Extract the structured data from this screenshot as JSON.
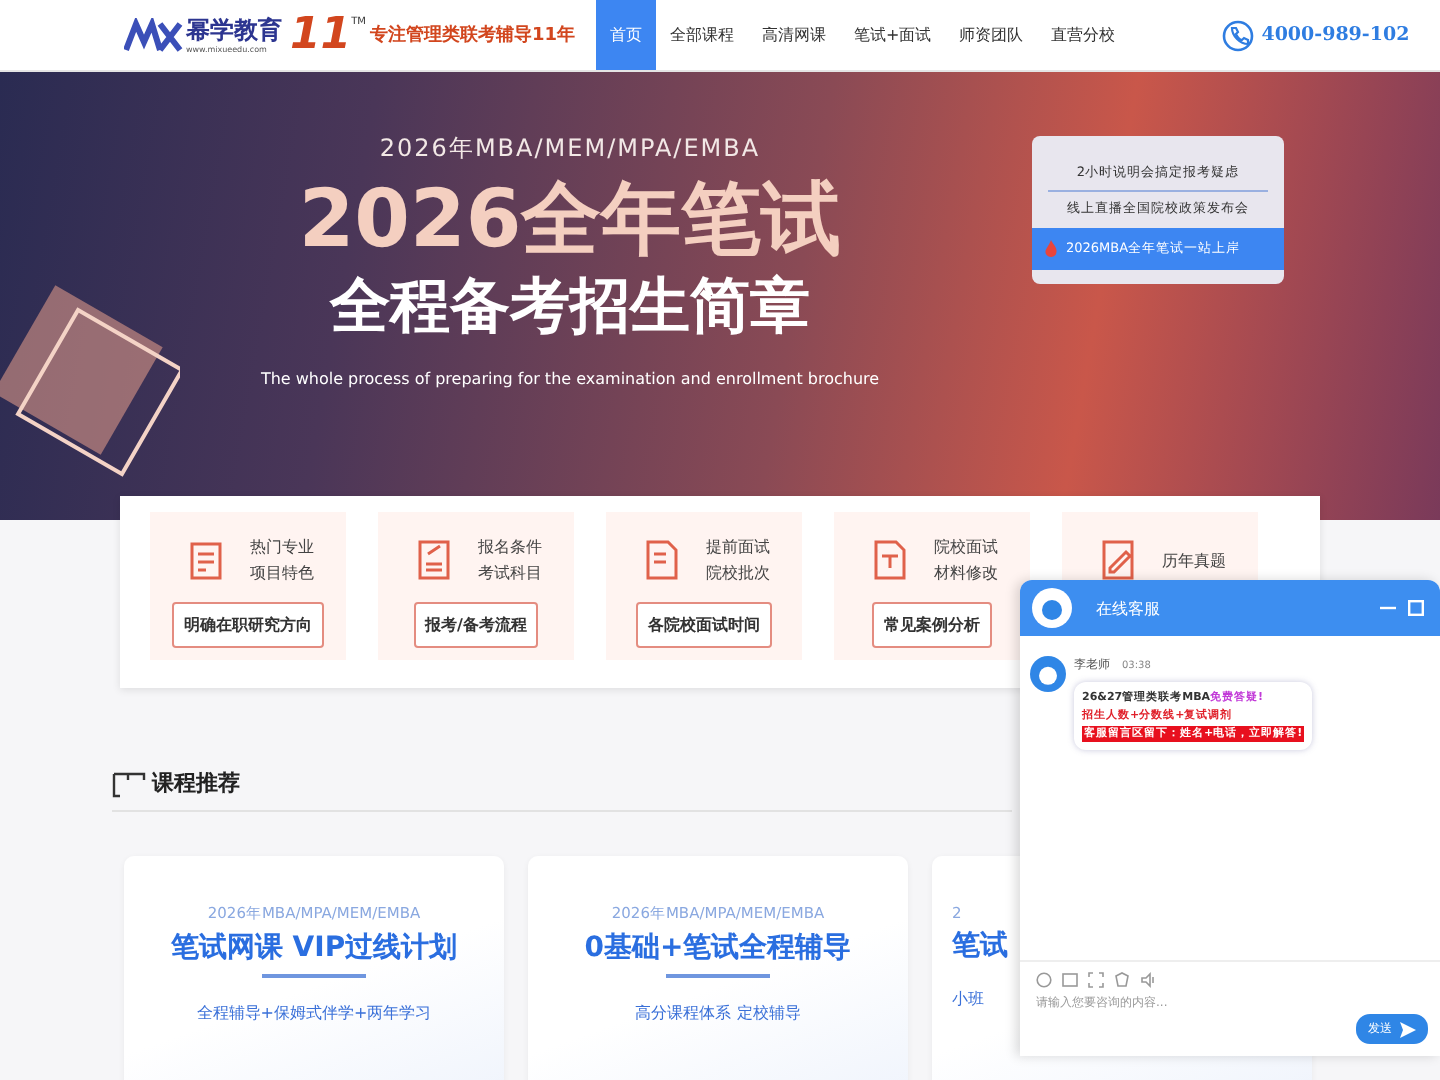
{
  "header": {
    "logo": {
      "brand": "幂学教育",
      "url": "www.mixueedu.com",
      "years": "11",
      "tm": "TM",
      "slogan": "专注管理类联考辅导11年"
    },
    "nav": [
      {
        "label": "首页",
        "selected": true
      },
      {
        "label": "全部课程",
        "selected": false
      },
      {
        "label": "高清网课",
        "selected": false
      },
      {
        "label": "笔试+面试",
        "selected": false
      },
      {
        "label": "师资团队",
        "selected": false
      },
      {
        "label": "直营分校",
        "selected": false
      }
    ],
    "phone": "4000-989-102"
  },
  "banner": {
    "kicker": "2026年MBA/MEM/MPA/EMBA",
    "title": "2026全年笔试",
    "subtitle": "全程备考招生简章",
    "english": "The whole process of preparing for the examination and enrollment brochure",
    "links": [
      {
        "label": "2小时说明会搞定报考疑虑",
        "selected": false
      },
      {
        "label": "线上直播全国院校政策发布会",
        "selected": false
      },
      {
        "label": "2026MBA全年笔试一站上岸",
        "selected": true
      }
    ]
  },
  "features": [
    {
      "lines": [
        "热门专业",
        "项目特色"
      ],
      "button": "明确在职研究方向"
    },
    {
      "lines": [
        "报名条件",
        "考试科目"
      ],
      "button": "报考/备考流程"
    },
    {
      "lines": [
        "提前面试",
        "院校批次"
      ],
      "button": "各院校面试时间"
    },
    {
      "lines": [
        "院校面试",
        "材料修改"
      ],
      "button": "常见案例分析"
    },
    {
      "lines": [
        "历年真题"
      ]
    }
  ],
  "section": {
    "title": "课程推荐"
  },
  "cards": [
    {
      "kind": "full",
      "kicker": "2026年MBA/MPA/MEM/EMBA",
      "title": "笔试网课 VIP过线计划",
      "tagline": "全程辅导+保姆式伴学+两年学习"
    },
    {
      "kind": "full",
      "kicker": "2026年MBA/MPA/MEM/EMBA",
      "title": "0基础+笔试全程辅导",
      "tagline": "高分课程体系 定校辅导"
    },
    {
      "kind": "cut",
      "kicker": "2",
      "title": "笔试",
      "tagline": "小班"
    }
  ],
  "chat": {
    "title": "在线客服",
    "agent": "李老师",
    "time": "03:38",
    "lines": [
      "26&27管理类联考MBA**免费答疑!**",
      "招生人数+分数线+复试调剂",
      "客服留言区留下：姓名+电话，立即解答!"
    ],
    "placeholder": "请输入您要咨询的内容...",
    "send": "发送"
  }
}
